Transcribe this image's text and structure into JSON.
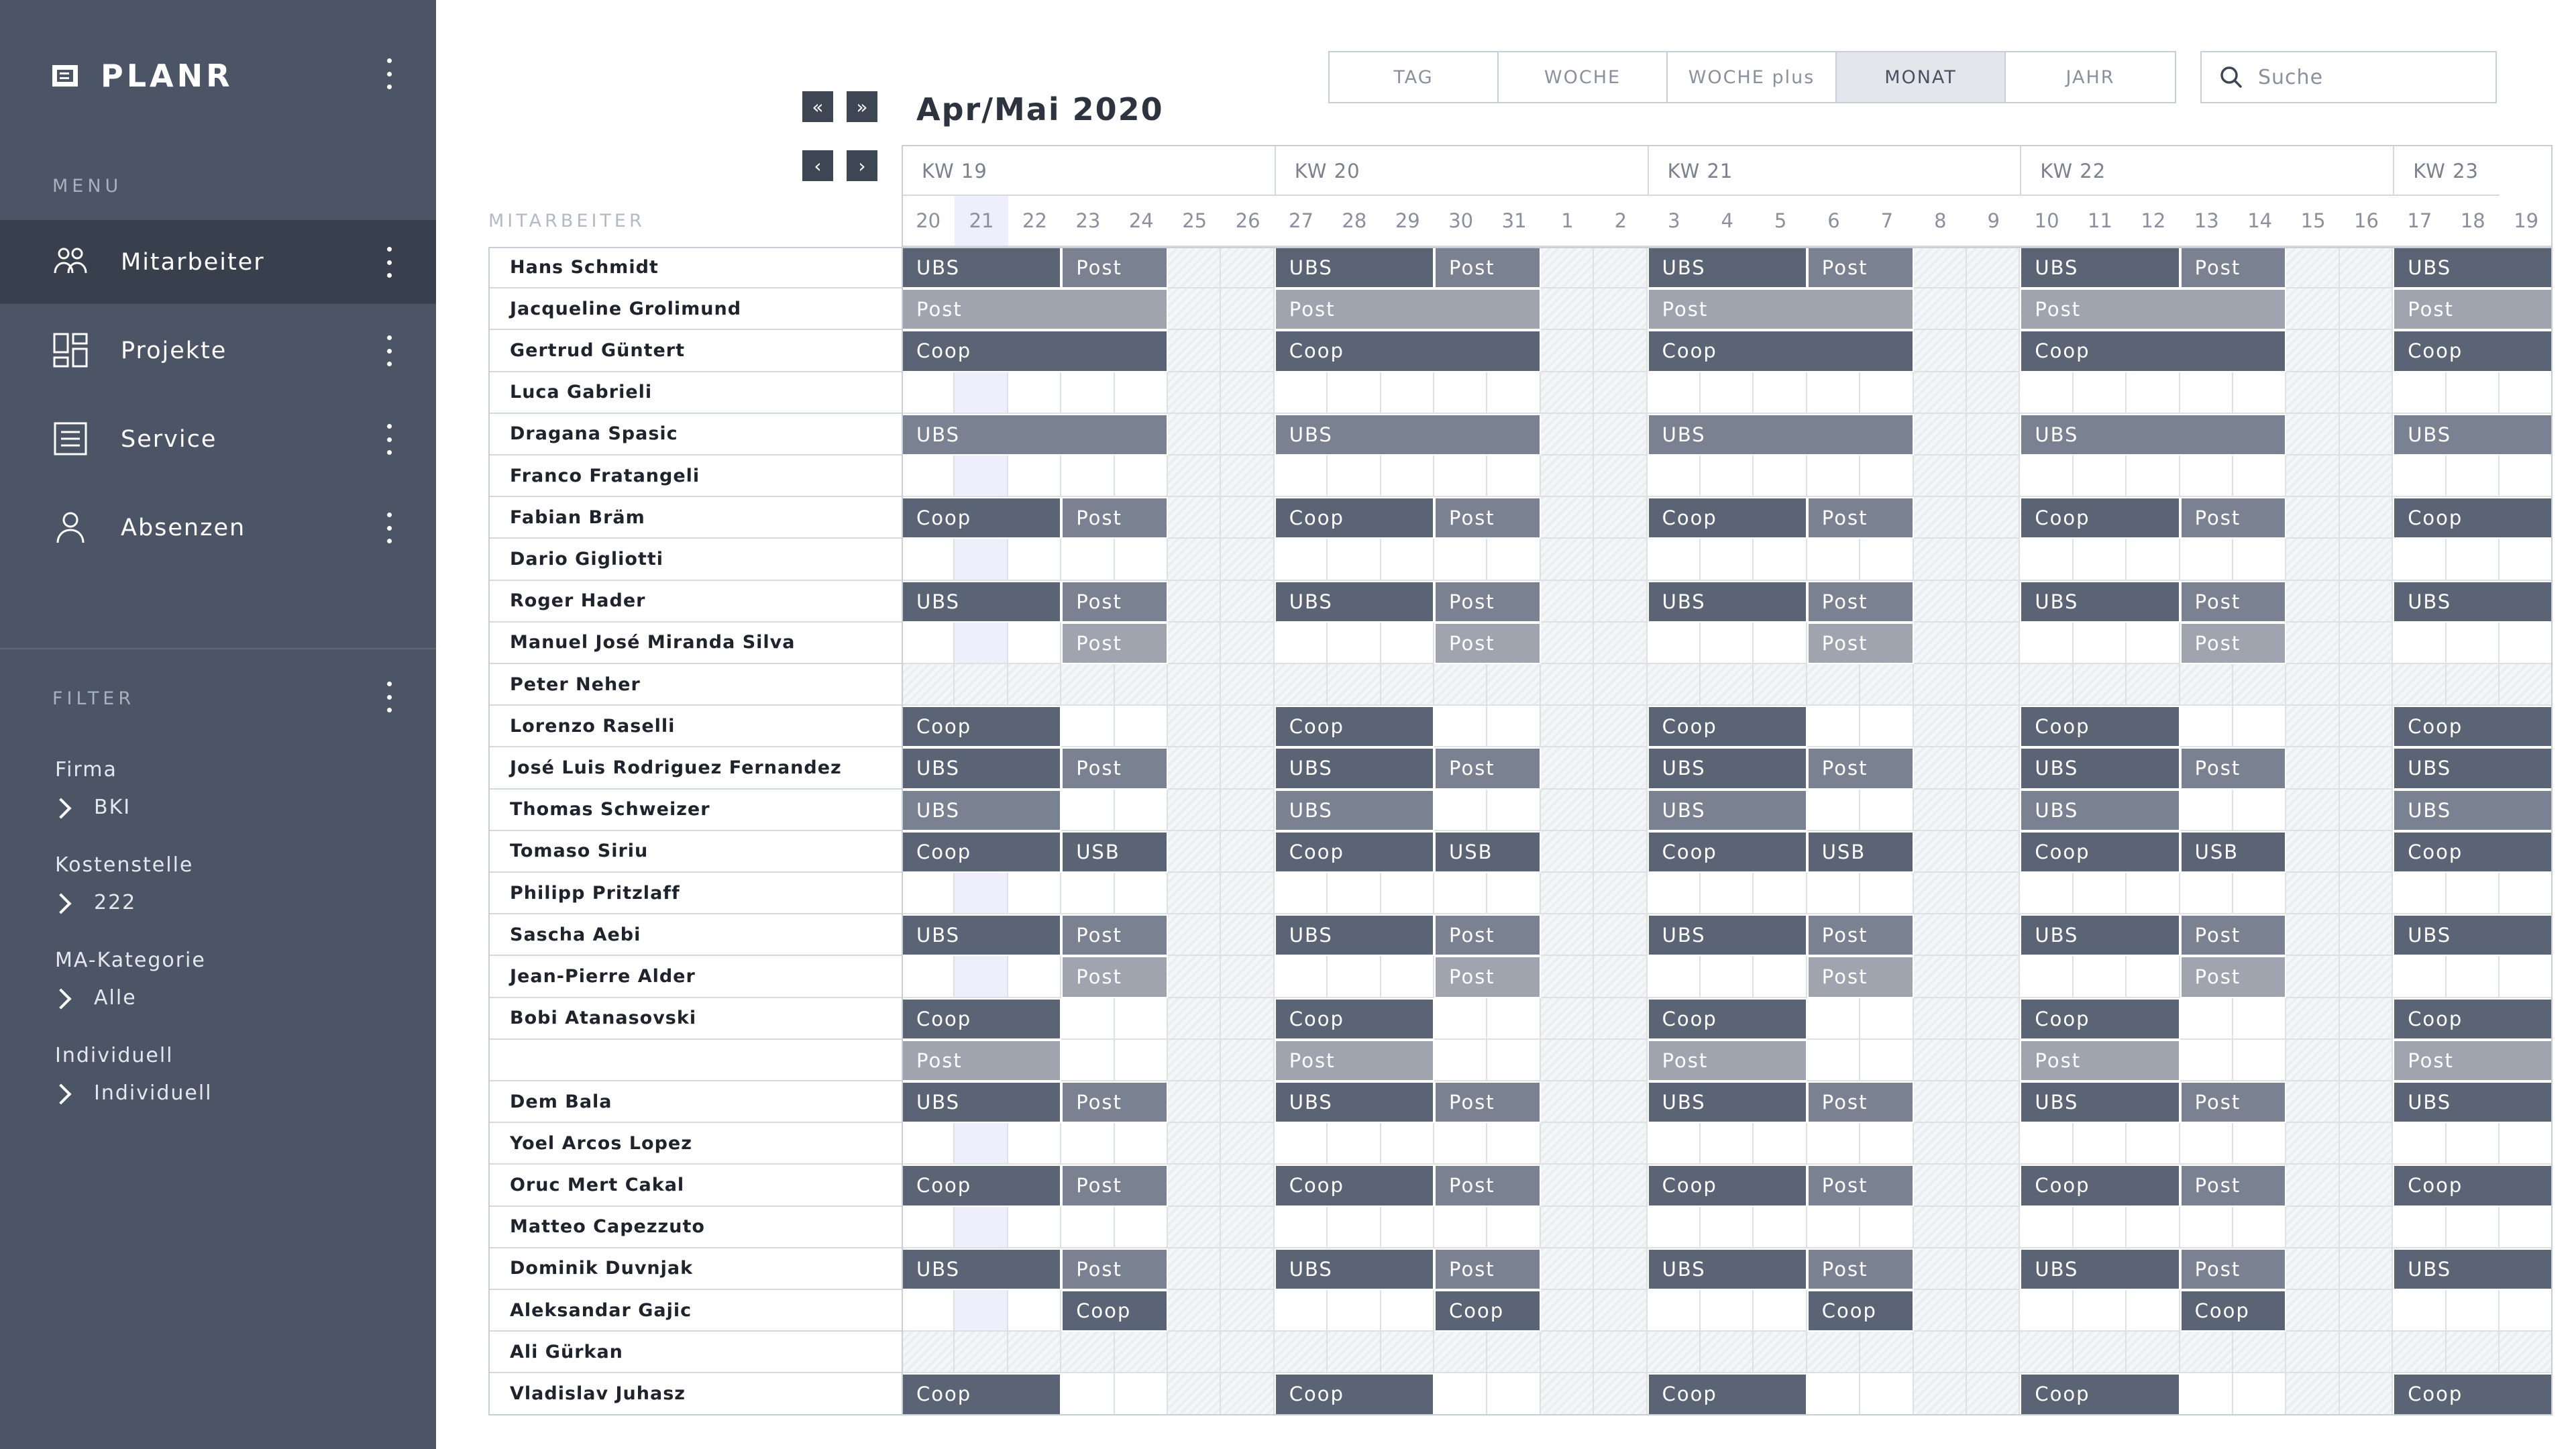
{
  "app": {
    "name": "PLANR",
    "menu_label": "MENU",
    "filter_label": "FILTER",
    "nav": [
      {
        "label": "Mitarbeiter",
        "icon": "people-icon",
        "active": true
      },
      {
        "label": "Projekte",
        "icon": "dashboard-icon",
        "active": false
      },
      {
        "label": "Service",
        "icon": "document-icon",
        "active": false
      },
      {
        "label": "Absenzen",
        "icon": "person-icon",
        "active": false
      }
    ],
    "filters": [
      {
        "title": "Firma",
        "value": "BKI"
      },
      {
        "title": "Kostenstelle",
        "value": "222"
      },
      {
        "title": "MA-Kategorie",
        "value": "Alle"
      },
      {
        "title": "Individuell",
        "value": "Individuell"
      }
    ]
  },
  "toolbar": {
    "views": [
      {
        "label": "TAG",
        "active": false
      },
      {
        "label": "WOCHE",
        "active": false
      },
      {
        "label": "WOCHE plus",
        "active": false
      },
      {
        "label": "MONAT",
        "active": true
      },
      {
        "label": "JAHR",
        "active": false
      }
    ],
    "search_placeholder": "Suche",
    "prev_fast": "«",
    "next_fast": "»",
    "prev": "‹",
    "next": "›"
  },
  "calendar": {
    "title": "Apr/Mai 2020",
    "column_header": "MITARBEITER",
    "weeks": [
      {
        "label": "KW 19",
        "days": 7
      },
      {
        "label": "KW 20",
        "days": 7
      },
      {
        "label": "KW 21",
        "days": 7
      },
      {
        "label": "KW 22",
        "days": 7
      },
      {
        "label": "KW 23",
        "days": 2
      }
    ],
    "days": [
      "20",
      "21",
      "22",
      "23",
      "24",
      "25",
      "26",
      "27",
      "28",
      "29",
      "30",
      "31",
      "1",
      "2",
      "3",
      "4",
      "5",
      "6",
      "7",
      "8",
      "9",
      "10",
      "11",
      "12",
      "13",
      "14",
      "15",
      "16",
      "17",
      "18",
      "19"
    ],
    "highlight_day_index": 1,
    "rows": [
      {
        "name": "Hans Schmidt",
        "pattern": "A"
      },
      {
        "name": "Jacqueline Grolimund",
        "pattern": "B"
      },
      {
        "name": "Gertrud Güntert",
        "pattern": "C"
      },
      {
        "name": "Luca Gabrieli",
        "pattern": "E"
      },
      {
        "name": "Dragana Spasic",
        "pattern": "D"
      },
      {
        "name": "Franco Fratangeli",
        "pattern": "E"
      },
      {
        "name": "Fabian Bräm",
        "pattern": "F"
      },
      {
        "name": "Dario Gigliotti",
        "pattern": "E"
      },
      {
        "name": "Roger Hader",
        "pattern": "A"
      },
      {
        "name": "Manuel José Miranda Silva",
        "pattern": "G"
      },
      {
        "name": "Peter Neher",
        "pattern": "H"
      },
      {
        "name": "Lorenzo Raselli",
        "pattern": "I"
      },
      {
        "name": "José Luis Rodriguez Fernandez",
        "pattern": "A"
      },
      {
        "name": "Thomas Schweizer",
        "pattern": "J"
      },
      {
        "name": "Tomaso Siriu",
        "pattern": "K"
      },
      {
        "name": "Philipp Pritzlaff",
        "pattern": "E"
      },
      {
        "name": "Sascha Aebi",
        "pattern": "A"
      },
      {
        "name": "Jean-Pierre Alder",
        "pattern": "G"
      },
      {
        "name": "Bobi Atanasovski",
        "pattern": "I"
      },
      {
        "name": "",
        "pattern": "L"
      },
      {
        "name": "Dem Bala",
        "pattern": "A"
      },
      {
        "name": "Yoel Arcos Lopez",
        "pattern": "E"
      },
      {
        "name": "Oruc Mert Cakal",
        "pattern": "F"
      },
      {
        "name": "Matteo Capezzuto",
        "pattern": "E"
      },
      {
        "name": "Dominik Duvnjak",
        "pattern": "A"
      },
      {
        "name": "Aleksandar Gajic",
        "pattern": "M"
      },
      {
        "name": "Ali Gürkan",
        "pattern": "H"
      },
      {
        "name": "Vladislav Juhasz",
        "pattern": "I"
      }
    ],
    "patterns": {
      "A": [
        {
          "label": "UBS",
          "start": 0,
          "span": 3,
          "tone": "dark"
        },
        {
          "label": "Post",
          "start": 3,
          "span": 2,
          "tone": "mid"
        }
      ],
      "B": [
        {
          "label": "Post",
          "start": 0,
          "span": 5,
          "tone": "light"
        }
      ],
      "C": [
        {
          "label": "Coop",
          "start": 0,
          "span": 5,
          "tone": "dark"
        }
      ],
      "D": [
        {
          "label": "UBS",
          "start": 0,
          "span": 5,
          "tone": "mid"
        }
      ],
      "E": [],
      "F": [
        {
          "label": "Coop",
          "start": 0,
          "span": 3,
          "tone": "dark"
        },
        {
          "label": "Post",
          "start": 3,
          "span": 2,
          "tone": "mid"
        }
      ],
      "G": [
        {
          "label": "Post",
          "start": 3,
          "span": 2,
          "tone": "light"
        }
      ],
      "H": [],
      "I": [
        {
          "label": "Coop",
          "start": 0,
          "span": 3,
          "tone": "dark"
        }
      ],
      "J": [
        {
          "label": "UBS",
          "start": 0,
          "span": 3,
          "tone": "mid"
        }
      ],
      "K": [
        {
          "label": "Coop",
          "start": 0,
          "span": 3,
          "tone": "dark"
        },
        {
          "label": "USB",
          "start": 3,
          "span": 2,
          "tone": "dark"
        }
      ],
      "L": [
        {
          "label": "Post",
          "start": 0,
          "span": 3,
          "tone": "light"
        }
      ],
      "M": [
        {
          "label": "Coop",
          "start": 3,
          "span": 2,
          "tone": "dark"
        }
      ]
    }
  }
}
